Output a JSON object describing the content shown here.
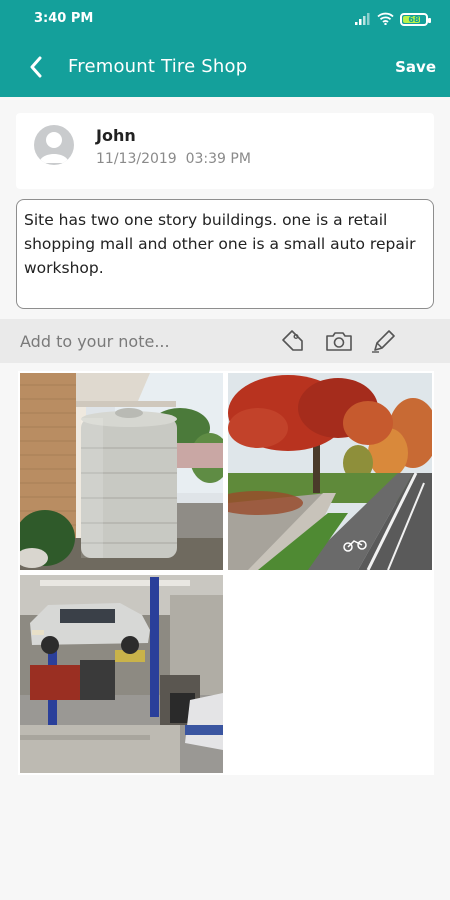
{
  "status_bar": {
    "time": "3:40 PM",
    "battery": "68"
  },
  "header": {
    "title": "Fremount Tire Shop",
    "save_label": "Save"
  },
  "note": {
    "author": "John",
    "date": "11/13/2019",
    "time": "03:39 PM",
    "text": "Site has two one story buildings. one is a retail shopping mall and other one is a small auto repair workshop."
  },
  "add_bar": {
    "placeholder": "Add to your note..."
  },
  "icons": {
    "back": "chevron-left-icon",
    "tag": "tag-icon",
    "camera": "camera-icon",
    "pen": "pen-icon",
    "signal": "signal-icon",
    "wifi": "wifi-icon",
    "battery": "battery-icon"
  },
  "colors": {
    "primary": "#14a09b",
    "battery_fill": "#b7f24a"
  }
}
